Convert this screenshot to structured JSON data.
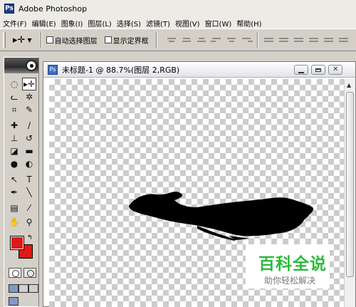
{
  "app": {
    "title": "Adobe Photoshop",
    "icon": "photoshop-icon"
  },
  "menu": [
    "文件(F)",
    "编辑(E)",
    "图象(I)",
    "图层(L)",
    "选择(S)",
    "滤镜(T)",
    "视图(V)",
    "窗口(W)",
    "帮助(H)"
  ],
  "options": {
    "tool_preset_icon": "move-tool-icon",
    "auto_select_layer": {
      "label": "自动选择图层",
      "checked": false
    },
    "show_bounding_box": {
      "label": "显示定界框",
      "checked": false
    },
    "align_buttons": [
      "align-top-icon",
      "align-vcenter-icon",
      "align-bottom-icon",
      "align-left-icon",
      "align-hcenter-icon",
      "align-right-icon"
    ],
    "distribute_buttons": [
      "distribute-top-icon",
      "distribute-vcenter-icon",
      "distribute-bottom-icon",
      "distribute-left-icon",
      "distribute-hcenter-icon",
      "distribute-right-icon"
    ]
  },
  "toolbox": {
    "tools": [
      {
        "name": "marquee-tool",
        "glyph": "◌"
      },
      {
        "name": "move-tool",
        "glyph": "▸✛",
        "selected": true
      },
      {
        "name": "lasso-tool",
        "glyph": "ᓚ"
      },
      {
        "name": "magic-wand-tool",
        "glyph": "✲"
      },
      {
        "name": "crop-tool",
        "glyph": "⌗"
      },
      {
        "name": "slice-tool",
        "glyph": "✎"
      },
      {
        "name": "healing-brush-tool",
        "glyph": "✚"
      },
      {
        "name": "brush-tool",
        "glyph": "∕"
      },
      {
        "name": "clone-stamp-tool",
        "glyph": "⊥"
      },
      {
        "name": "history-brush-tool",
        "glyph": "↺"
      },
      {
        "name": "eraser-tool",
        "glyph": "◪"
      },
      {
        "name": "gradient-tool",
        "glyph": "▬"
      },
      {
        "name": "blur-tool",
        "glyph": "●"
      },
      {
        "name": "dodge-tool",
        "glyph": "◐"
      },
      {
        "name": "path-selection-tool",
        "glyph": "↖"
      },
      {
        "name": "type-tool",
        "glyph": "T"
      },
      {
        "name": "pen-tool",
        "glyph": "✒"
      },
      {
        "name": "line-tool",
        "glyph": "╲"
      },
      {
        "name": "notes-tool",
        "glyph": "▤"
      },
      {
        "name": "eyedropper-tool",
        "glyph": "⁄"
      },
      {
        "name": "hand-tool",
        "glyph": "✋"
      },
      {
        "name": "zoom-tool",
        "glyph": "⚲"
      }
    ],
    "foreground_color": "#e01818",
    "background_color": "#e01818"
  },
  "document": {
    "title": "未标题-1 @ 88.7%(图层 2,RGB)",
    "icon": "document-icon"
  },
  "watermark": {
    "title": "百科全说",
    "subtitle": "助你轻松解决"
  }
}
